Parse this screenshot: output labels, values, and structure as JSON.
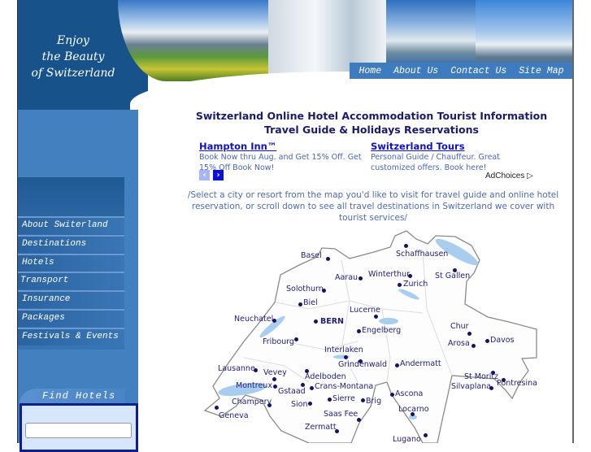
{
  "header": {
    "tagline_lines": [
      "Enjoy",
      "the Beauty",
      "of Switzerland"
    ],
    "nav": [
      "Home",
      "About Us",
      "Contact Us",
      "Site Map"
    ]
  },
  "sidebar": {
    "menu": [
      "About Switerland",
      "Destinations",
      "Hotels",
      "Transport",
      "Insurance",
      "Packages",
      "Festivals & Events"
    ],
    "find_hotels": {
      "title": "Find Hotels",
      "input_value": ""
    }
  },
  "main": {
    "title": "Switzerland Online Hotel Accommodation Tourist Information Travel Guide & Holidays Reservations",
    "ads": [
      {
        "title": "Hampton Inn™",
        "desc": "Book Now thru Aug. and Get 15% Off. Get 15% Off Book Now!"
      },
      {
        "title": "Switzerland Tours",
        "desc": "Personal Guide / Chauffeur. Great customized offers. Book here!"
      }
    ],
    "ad_prev": "‹",
    "ad_next": "›",
    "adchoices": "AdChoices ▷",
    "intro": "/Select a city or resort from the map you'd like to visit for travel guide and online hotel reservation, or scroll down to see all travel destinations in Switzerland we cover with tourist services/"
  },
  "map": {
    "cities": [
      "Schaffhausen",
      "Basel",
      "Aarau",
      "Winterthur",
      "Zurich",
      "St Gallen",
      "Solothurn",
      "Biel",
      "Neuchatel",
      "BERN",
      "Lucerne",
      "Engelberg",
      "Fribourg",
      "Interlaken",
      "Grindenwald",
      "Andermatt",
      "Chur",
      "Arosa",
      "Davos",
      "Lausanne",
      "Vevey",
      "Montreux",
      "Adelboden",
      "Gstaad",
      "Crans-Montana",
      "Sierre",
      "Sion",
      "Brig",
      "Champery",
      "Geneva",
      "Saas Fee",
      "Zermatt",
      "Ascona",
      "Locarno",
      "Lugano",
      "St Moritz",
      "Silvaplana",
      "Pontresina"
    ]
  },
  "colors": {
    "dark_blue": "#18528a",
    "sidebar": "#4380c0",
    "lake": "#a8cdef",
    "city": "#22227a"
  }
}
